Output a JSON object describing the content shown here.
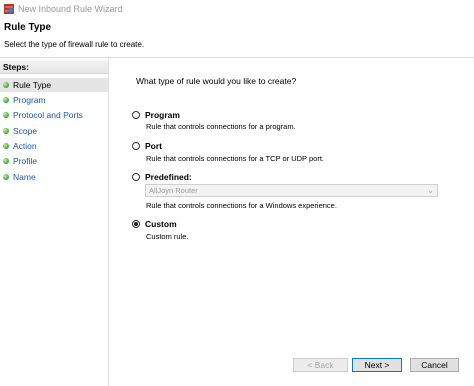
{
  "window": {
    "title": "New Inbound Rule Wizard",
    "icon": "firewall-shield-icon"
  },
  "header": {
    "title": "Rule Type",
    "subtitle": "Select the type of firewall rule to create."
  },
  "steps": {
    "heading": "Steps:",
    "items": [
      {
        "label": "Rule Type",
        "current": true
      },
      {
        "label": "Program"
      },
      {
        "label": "Protocol and Ports"
      },
      {
        "label": "Scope"
      },
      {
        "label": "Action"
      },
      {
        "label": "Profile"
      },
      {
        "label": "Name"
      }
    ]
  },
  "main": {
    "question": "What type of rule would you like to create?",
    "options": [
      {
        "label": "Program",
        "description": "Rule that controls connections for a program.",
        "selected": false
      },
      {
        "label": "Port",
        "description": "Rule that controls connections for a TCP or UDP port.",
        "selected": false
      },
      {
        "label": "Predefined:",
        "description": "Rule that controls connections for a Windows experience.",
        "selected": false,
        "dropdown_value": "AllJoyn Router"
      },
      {
        "label": "Custom",
        "description": "Custom rule.",
        "selected": true
      }
    ]
  },
  "buttons": {
    "back": "< Back",
    "next": "Next >",
    "cancel": "Cancel"
  },
  "colors": {
    "step_link": "#1a56b8",
    "primary_border": "#0078d7"
  }
}
